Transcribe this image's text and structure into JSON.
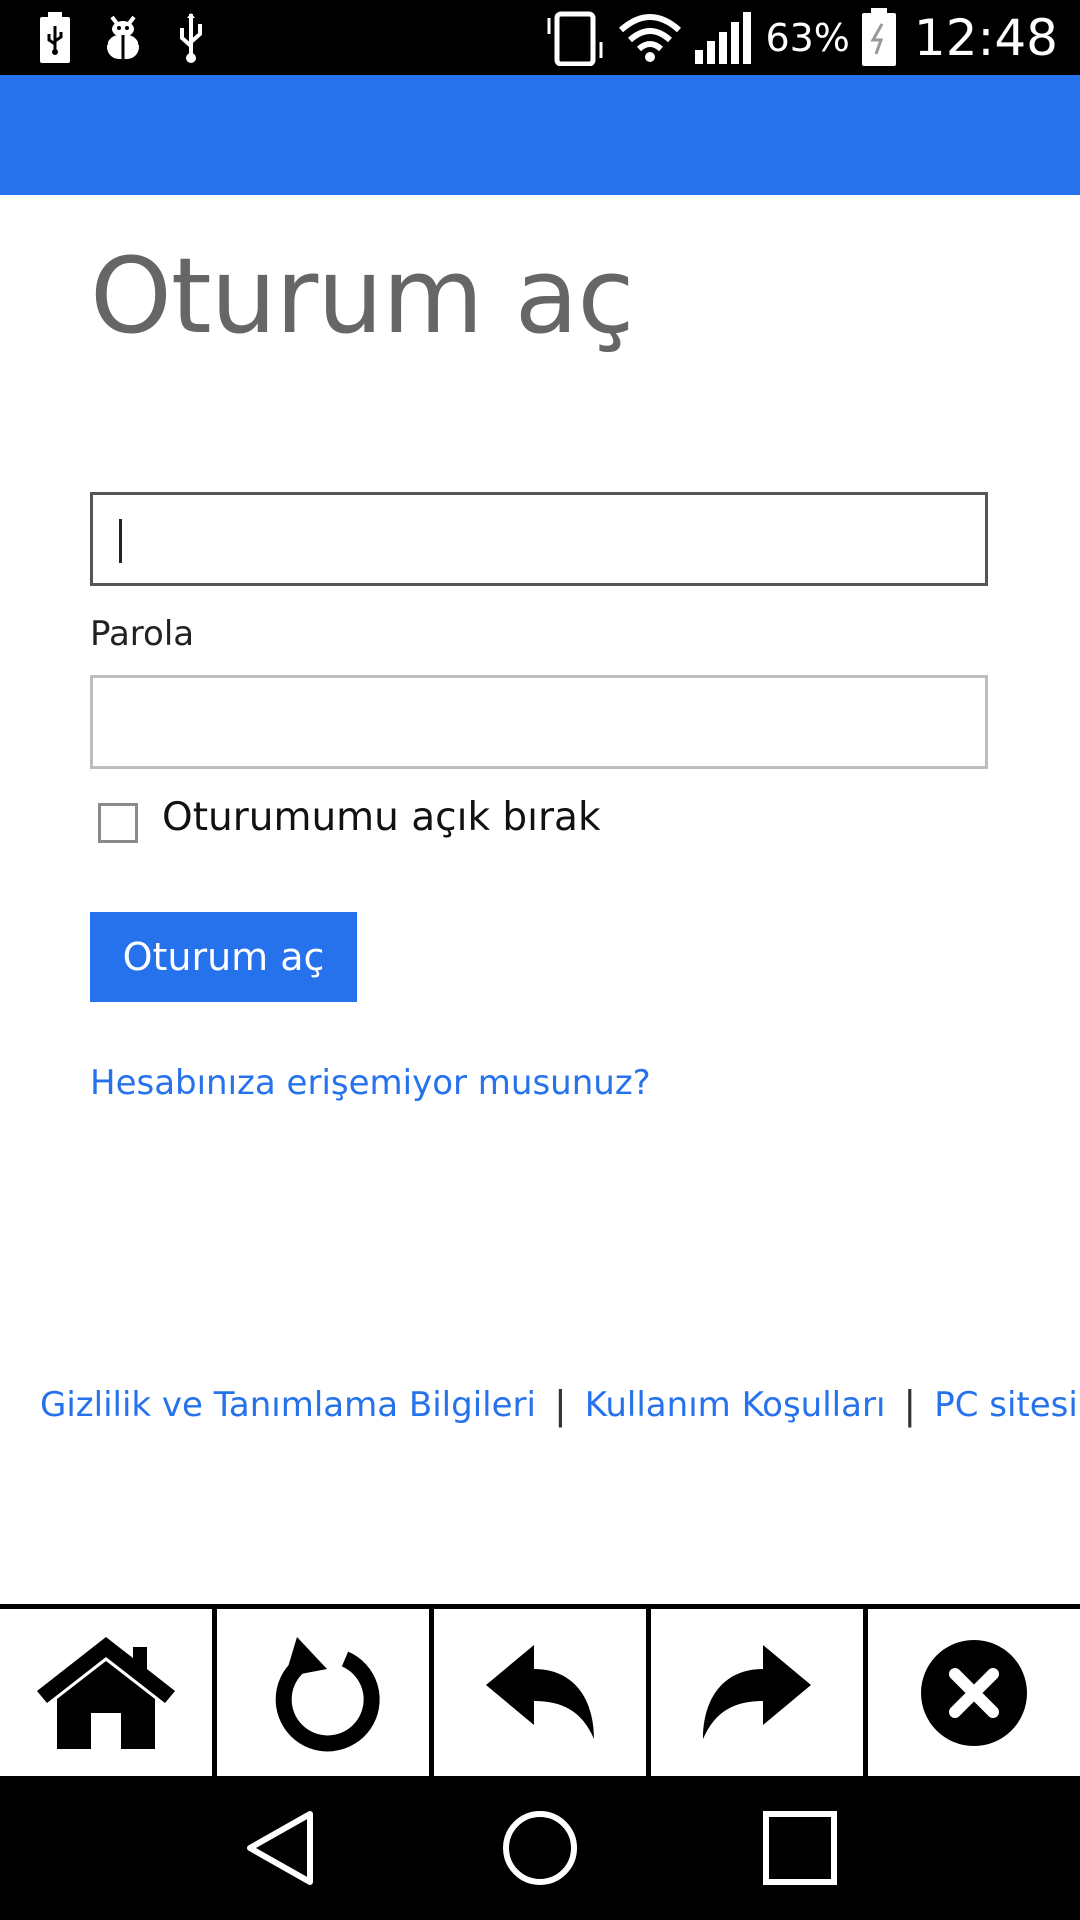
{
  "status_bar": {
    "left_icons": [
      "usb-icon",
      "bug-icon",
      "usb-icon"
    ],
    "right_icons": [
      "vibrate-icon",
      "wifi-icon",
      "signal-icon"
    ],
    "battery_percent": "63%",
    "time": "12:48"
  },
  "colors": {
    "accent": "#2672ec",
    "title_gray": "#666666"
  },
  "main": {
    "title": "Oturum aç",
    "username": {
      "value": "",
      "placeholder": ""
    },
    "password_label": "Parola",
    "password": {
      "value": "",
      "placeholder": ""
    },
    "keep_signed_in": {
      "label": "Oturumumu açık bırak",
      "checked": false
    },
    "signin_button": "Oturum aç",
    "help_link": "Hesabınıza erişemiyor musunuz?"
  },
  "footer": {
    "links": [
      "Gizlilik ve Tanımlama Bilgileri",
      "Kullanım Koşulları",
      "PC sitesi"
    ],
    "separator": "|"
  },
  "toolbar": {
    "buttons": [
      "home-icon",
      "refresh-icon",
      "back-arrow-icon",
      "forward-arrow-icon",
      "close-icon"
    ]
  },
  "navbar": {
    "buttons": [
      "back-triangle-icon",
      "home-circle-icon",
      "recents-square-icon"
    ]
  }
}
